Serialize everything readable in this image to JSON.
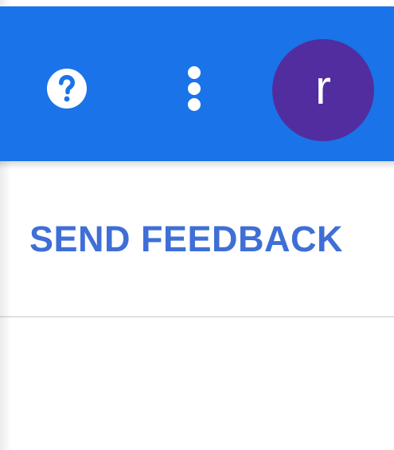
{
  "app_bar": {
    "background_color": "#1a73e8",
    "help_icon": "help-circle-icon",
    "more_icon": "more-vert-icon",
    "avatar": {
      "letter": "r",
      "color": "#522d9f"
    }
  },
  "menu": {
    "send_feedback_label": "SEND FEEDBACK",
    "link_color": "#3f6fd6"
  }
}
